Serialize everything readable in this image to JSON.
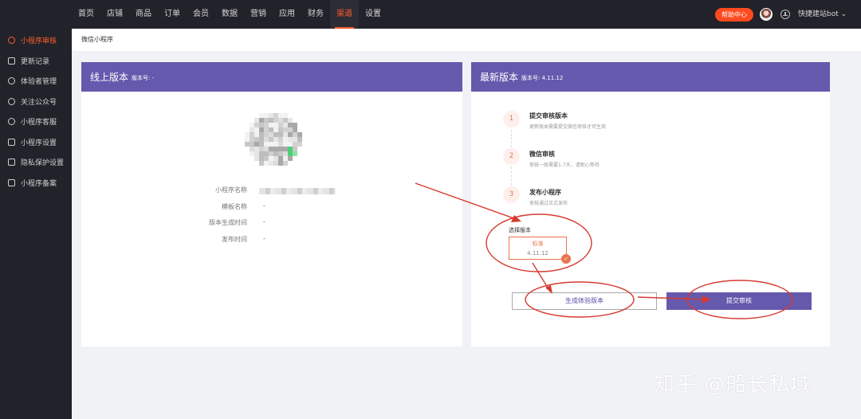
{
  "topnav": {
    "items": [
      "首页",
      "店铺",
      "商品",
      "订单",
      "会员",
      "数据",
      "营销",
      "应用",
      "财务",
      "渠道",
      "设置"
    ],
    "active_index": 9,
    "help_label": "帮助中心",
    "user_name": "快捷建站bot ⌄"
  },
  "sidebar": {
    "items": [
      {
        "label": "小程序审核",
        "icon": "link-icon",
        "active": true
      },
      {
        "label": "更新记录",
        "icon": "record-icon"
      },
      {
        "label": "体验者管理",
        "icon": "user-icon"
      },
      {
        "label": "关注公众号",
        "icon": "wechat-icon"
      },
      {
        "label": "小程序客服",
        "icon": "chat-icon"
      },
      {
        "label": "小程序设置",
        "icon": "settings-doc-icon"
      },
      {
        "label": "隐私保护设置",
        "icon": "privacy-doc-icon"
      },
      {
        "label": "小程序备案",
        "icon": "filing-doc-icon"
      }
    ]
  },
  "breadcrumb": "微信小程序",
  "online": {
    "title": "线上版本",
    "version_label": "版本号: -",
    "fields": [
      {
        "label": "小程序名称",
        "value": ""
      },
      {
        "label": "模板名称",
        "value": "-"
      },
      {
        "label": "版本生成时间",
        "value": "-"
      },
      {
        "label": "发布时间",
        "value": "-"
      }
    ]
  },
  "latest": {
    "title": "最新版本",
    "version_label": "版本号: 4.11.12",
    "steps": [
      {
        "num": "1",
        "title": "提交审核版本",
        "desc": "更新版本需要提交微信审核才可生效"
      },
      {
        "num": "2",
        "title": "微信审核",
        "desc": "审核一般需要1-7天，请耐心等待"
      },
      {
        "num": "3",
        "title": "发布小程序",
        "desc": "审核通过正式发布"
      }
    ],
    "select_label": "选择版本",
    "option": {
      "name": "标准",
      "version": "4.11.12"
    },
    "check_mark": "✓",
    "btn_experience": "生成体验版本",
    "btn_submit": "提交审核"
  },
  "watermark": "知乎 @船长私域",
  "colors": {
    "accent": "#ff5a2a",
    "brand": "#6559ad",
    "annotation": "#d63a2f"
  }
}
